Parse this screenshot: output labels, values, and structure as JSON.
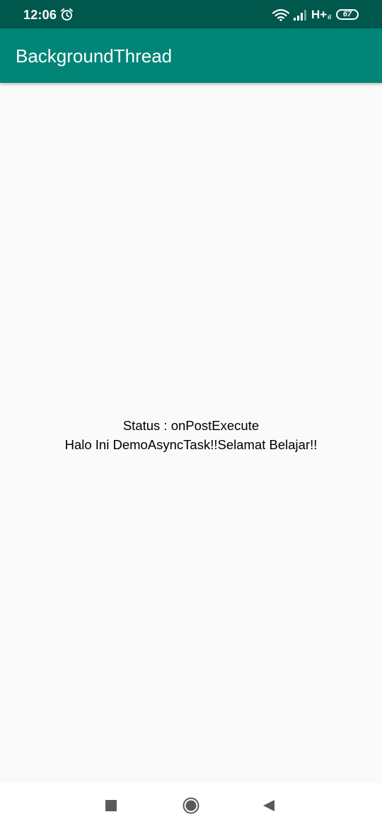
{
  "status_bar": {
    "time": "12:06",
    "network_type": "H+",
    "network_sub": "ıl",
    "battery": "67",
    "icons": [
      "alarm-icon",
      "wifi-icon",
      "signal-icon",
      "battery-icon"
    ]
  },
  "app_bar": {
    "title": "BackgroundThread",
    "color": "#008577",
    "status_color": "#00574b"
  },
  "main": {
    "status_label": "Status : onPostExecute",
    "message": "Halo Ini DemoAsyncTask!!Selamat Belajar!!"
  },
  "nav_bar": {
    "buttons": [
      "recents-button",
      "home-button",
      "back-button"
    ]
  }
}
